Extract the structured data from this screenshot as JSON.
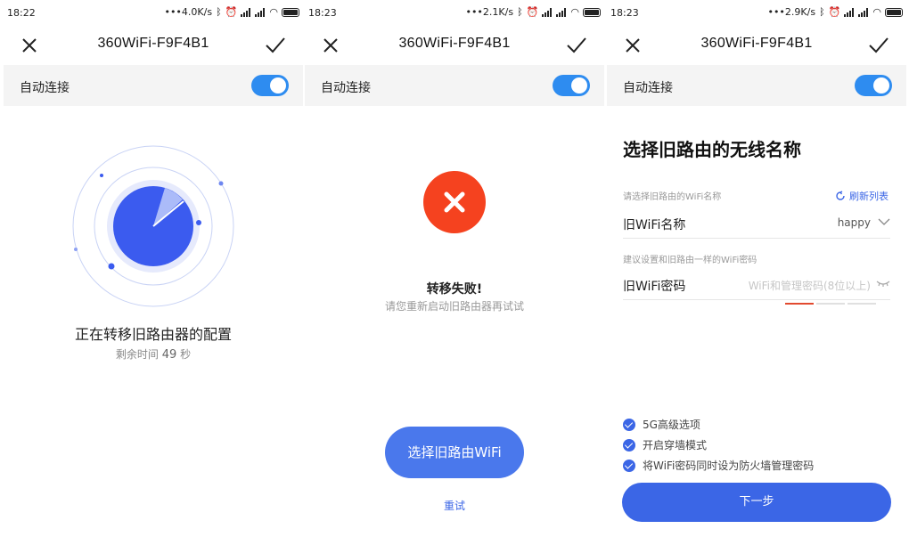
{
  "colors": {
    "accent": "#3b66e6",
    "toggle": "#2e8cf0",
    "error": "#f5421f"
  },
  "panels": [
    {
      "status": {
        "time": "18:22",
        "speed": "4.0K/s"
      },
      "title": "360WiFi-F9F4B1",
      "auto_connect": {
        "label": "自动连接",
        "on": true
      },
      "progress": {
        "title": "正在转移旧路由器的配置",
        "remaining_prefix": "剩余时间",
        "seconds": "49",
        "unit": "秒"
      }
    },
    {
      "status": {
        "time": "18:23",
        "speed": "2.1K/s"
      },
      "title": "360WiFi-F9F4B1",
      "auto_connect": {
        "label": "自动连接",
        "on": true
      },
      "error": {
        "title": "转移失败!",
        "subtitle": "请您重新启动旧路由器再试试"
      },
      "primary_button": "选择旧路由WiFi",
      "retry": "重试"
    },
    {
      "status": {
        "time": "18:23",
        "speed": "2.9K/s"
      },
      "title": "360WiFi-F9F4B1",
      "auto_connect": {
        "label": "自动连接",
        "on": true
      },
      "heading": "选择旧路由的无线名称",
      "ssid_hint": "请选择旧路由的WiFi名称",
      "refresh": "刷新列表",
      "ssid_label": "旧WiFi名称",
      "ssid_value": "happy",
      "pwd_hint": "建议设置和旧路由一样的WiFi密码",
      "pwd_label": "旧WiFi密码",
      "pwd_placeholder": "WiFi和管理密码(8位以上)",
      "options": [
        "5G高级选项",
        "开启穿墙模式",
        "将WiFi密码同时设为防火墙管理密码"
      ],
      "next": "下一步"
    }
  ]
}
